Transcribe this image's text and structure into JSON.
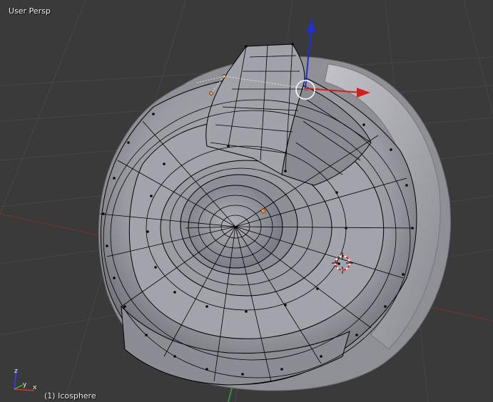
{
  "viewport": {
    "view_label": "User Persp",
    "object_label": "(1) Icosphere"
  },
  "icons": {
    "manipulator": "transform-manipulator-icon",
    "cursor": "3d-cursor-icon",
    "axes": "axis-orientation-icon"
  },
  "colors": {
    "background": "#3a3a3a",
    "grid": "#4a4a4a",
    "x_axis": "#8a3434",
    "y_axis": "#3c8a3c",
    "z_axis": "#1f2fd6",
    "mesh": "#9a9aa0",
    "wire": "#000000",
    "selected": "#f08c30"
  }
}
